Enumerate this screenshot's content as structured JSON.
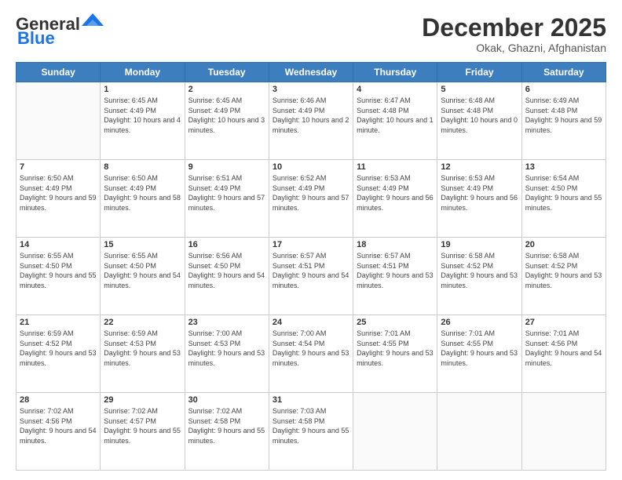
{
  "header": {
    "logo_general": "General",
    "logo_blue": "Blue",
    "month": "December 2025",
    "location": "Okak, Ghazni, Afghanistan"
  },
  "weekdays": [
    "Sunday",
    "Monday",
    "Tuesday",
    "Wednesday",
    "Thursday",
    "Friday",
    "Saturday"
  ],
  "weeks": [
    [
      {
        "day": "",
        "sunrise": "",
        "sunset": "",
        "daylight": ""
      },
      {
        "day": "1",
        "sunrise": "Sunrise: 6:45 AM",
        "sunset": "Sunset: 4:49 PM",
        "daylight": "Daylight: 10 hours and 4 minutes."
      },
      {
        "day": "2",
        "sunrise": "Sunrise: 6:45 AM",
        "sunset": "Sunset: 4:49 PM",
        "daylight": "Daylight: 10 hours and 3 minutes."
      },
      {
        "day": "3",
        "sunrise": "Sunrise: 6:46 AM",
        "sunset": "Sunset: 4:49 PM",
        "daylight": "Daylight: 10 hours and 2 minutes."
      },
      {
        "day": "4",
        "sunrise": "Sunrise: 6:47 AM",
        "sunset": "Sunset: 4:48 PM",
        "daylight": "Daylight: 10 hours and 1 minute."
      },
      {
        "day": "5",
        "sunrise": "Sunrise: 6:48 AM",
        "sunset": "Sunset: 4:48 PM",
        "daylight": "Daylight: 10 hours and 0 minutes."
      },
      {
        "day": "6",
        "sunrise": "Sunrise: 6:49 AM",
        "sunset": "Sunset: 4:48 PM",
        "daylight": "Daylight: 9 hours and 59 minutes."
      }
    ],
    [
      {
        "day": "7",
        "sunrise": "Sunrise: 6:50 AM",
        "sunset": "Sunset: 4:49 PM",
        "daylight": "Daylight: 9 hours and 59 minutes."
      },
      {
        "day": "8",
        "sunrise": "Sunrise: 6:50 AM",
        "sunset": "Sunset: 4:49 PM",
        "daylight": "Daylight: 9 hours and 58 minutes."
      },
      {
        "day": "9",
        "sunrise": "Sunrise: 6:51 AM",
        "sunset": "Sunset: 4:49 PM",
        "daylight": "Daylight: 9 hours and 57 minutes."
      },
      {
        "day": "10",
        "sunrise": "Sunrise: 6:52 AM",
        "sunset": "Sunset: 4:49 PM",
        "daylight": "Daylight: 9 hours and 57 minutes."
      },
      {
        "day": "11",
        "sunrise": "Sunrise: 6:53 AM",
        "sunset": "Sunset: 4:49 PM",
        "daylight": "Daylight: 9 hours and 56 minutes."
      },
      {
        "day": "12",
        "sunrise": "Sunrise: 6:53 AM",
        "sunset": "Sunset: 4:49 PM",
        "daylight": "Daylight: 9 hours and 56 minutes."
      },
      {
        "day": "13",
        "sunrise": "Sunrise: 6:54 AM",
        "sunset": "Sunset: 4:50 PM",
        "daylight": "Daylight: 9 hours and 55 minutes."
      }
    ],
    [
      {
        "day": "14",
        "sunrise": "Sunrise: 6:55 AM",
        "sunset": "Sunset: 4:50 PM",
        "daylight": "Daylight: 9 hours and 55 minutes."
      },
      {
        "day": "15",
        "sunrise": "Sunrise: 6:55 AM",
        "sunset": "Sunset: 4:50 PM",
        "daylight": "Daylight: 9 hours and 54 minutes."
      },
      {
        "day": "16",
        "sunrise": "Sunrise: 6:56 AM",
        "sunset": "Sunset: 4:50 PM",
        "daylight": "Daylight: 9 hours and 54 minutes."
      },
      {
        "day": "17",
        "sunrise": "Sunrise: 6:57 AM",
        "sunset": "Sunset: 4:51 PM",
        "daylight": "Daylight: 9 hours and 54 minutes."
      },
      {
        "day": "18",
        "sunrise": "Sunrise: 6:57 AM",
        "sunset": "Sunset: 4:51 PM",
        "daylight": "Daylight: 9 hours and 53 minutes."
      },
      {
        "day": "19",
        "sunrise": "Sunrise: 6:58 AM",
        "sunset": "Sunset: 4:52 PM",
        "daylight": "Daylight: 9 hours and 53 minutes."
      },
      {
        "day": "20",
        "sunrise": "Sunrise: 6:58 AM",
        "sunset": "Sunset: 4:52 PM",
        "daylight": "Daylight: 9 hours and 53 minutes."
      }
    ],
    [
      {
        "day": "21",
        "sunrise": "Sunrise: 6:59 AM",
        "sunset": "Sunset: 4:52 PM",
        "daylight": "Daylight: 9 hours and 53 minutes."
      },
      {
        "day": "22",
        "sunrise": "Sunrise: 6:59 AM",
        "sunset": "Sunset: 4:53 PM",
        "daylight": "Daylight: 9 hours and 53 minutes."
      },
      {
        "day": "23",
        "sunrise": "Sunrise: 7:00 AM",
        "sunset": "Sunset: 4:53 PM",
        "daylight": "Daylight: 9 hours and 53 minutes."
      },
      {
        "day": "24",
        "sunrise": "Sunrise: 7:00 AM",
        "sunset": "Sunset: 4:54 PM",
        "daylight": "Daylight: 9 hours and 53 minutes."
      },
      {
        "day": "25",
        "sunrise": "Sunrise: 7:01 AM",
        "sunset": "Sunset: 4:55 PM",
        "daylight": "Daylight: 9 hours and 53 minutes."
      },
      {
        "day": "26",
        "sunrise": "Sunrise: 7:01 AM",
        "sunset": "Sunset: 4:55 PM",
        "daylight": "Daylight: 9 hours and 53 minutes."
      },
      {
        "day": "27",
        "sunrise": "Sunrise: 7:01 AM",
        "sunset": "Sunset: 4:56 PM",
        "daylight": "Daylight: 9 hours and 54 minutes."
      }
    ],
    [
      {
        "day": "28",
        "sunrise": "Sunrise: 7:02 AM",
        "sunset": "Sunset: 4:56 PM",
        "daylight": "Daylight: 9 hours and 54 minutes."
      },
      {
        "day": "29",
        "sunrise": "Sunrise: 7:02 AM",
        "sunset": "Sunset: 4:57 PM",
        "daylight": "Daylight: 9 hours and 55 minutes."
      },
      {
        "day": "30",
        "sunrise": "Sunrise: 7:02 AM",
        "sunset": "Sunset: 4:58 PM",
        "daylight": "Daylight: 9 hours and 55 minutes."
      },
      {
        "day": "31",
        "sunrise": "Sunrise: 7:03 AM",
        "sunset": "Sunset: 4:58 PM",
        "daylight": "Daylight: 9 hours and 55 minutes."
      },
      {
        "day": "",
        "sunrise": "",
        "sunset": "",
        "daylight": ""
      },
      {
        "day": "",
        "sunrise": "",
        "sunset": "",
        "daylight": ""
      },
      {
        "day": "",
        "sunrise": "",
        "sunset": "",
        "daylight": ""
      }
    ]
  ]
}
